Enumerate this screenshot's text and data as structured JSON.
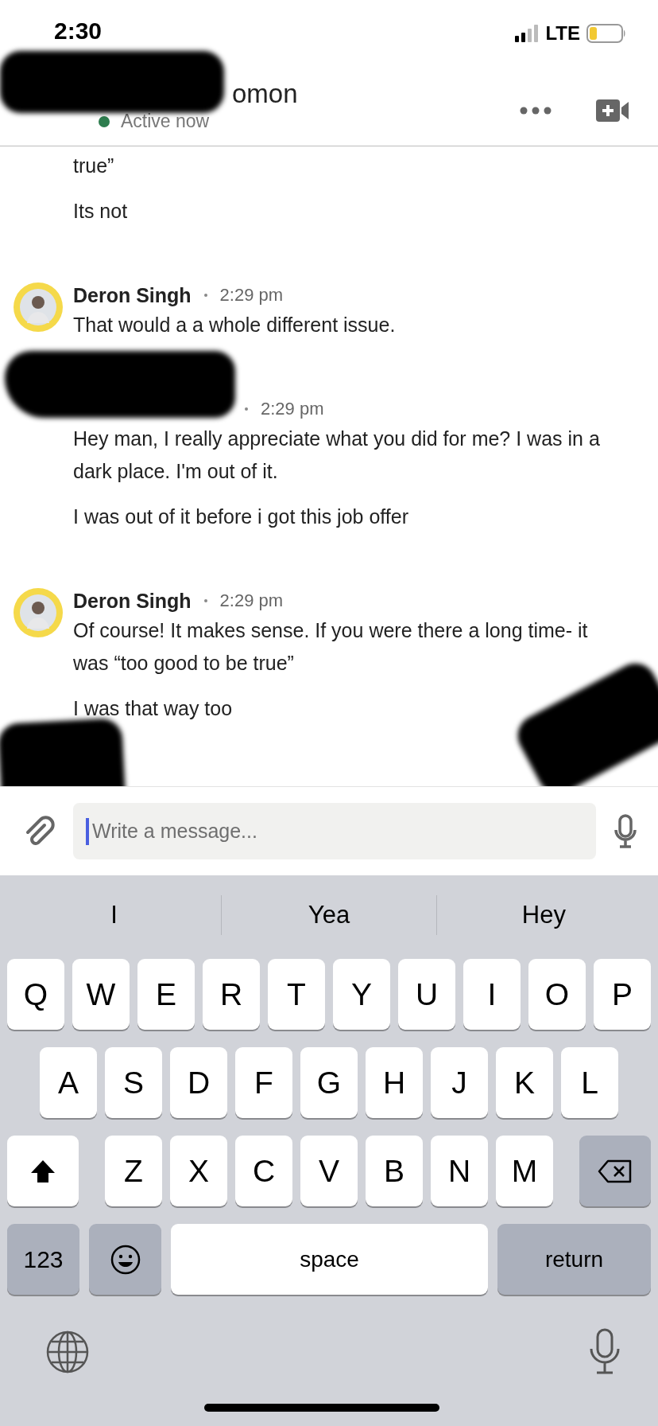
{
  "status_bar": {
    "time": "2:30",
    "network": "LTE"
  },
  "header": {
    "name": "omon",
    "presence": "Active now",
    "online": true,
    "redacted": true
  },
  "messages": [
    {
      "redacted": false,
      "lines": [
        "true”",
        "Its not"
      ]
    },
    {
      "author": "Deron Singh",
      "time": "2:29 pm",
      "redacted": false,
      "lines": [
        "That would a a whole different issue."
      ]
    },
    {
      "time": "2:29 pm",
      "redacted": true,
      "lines": [
        "Hey man, I really appreciate what you did for me? I was in a dark place. I'm out of it.",
        "I was out of it before i got this job offer"
      ]
    },
    {
      "author": "Deron Singh",
      "time": "2:29 pm",
      "redacted": true,
      "lines": [
        "Of course! It makes sense. If you were there a long time- it was “too good to be true”",
        "I was that way too"
      ]
    }
  ],
  "composer": {
    "placeholder": "Write a message..."
  },
  "keyboard": {
    "suggestions": [
      "I",
      "Yea",
      "Hey"
    ],
    "rows": [
      {
        "keys": [
          {
            "kind": "letter",
            "label": "Q"
          },
          {
            "kind": "letter",
            "label": "W"
          },
          {
            "kind": "letter",
            "label": "E"
          },
          {
            "kind": "letter",
            "label": "R"
          },
          {
            "kind": "letter",
            "label": "T"
          },
          {
            "kind": "letter",
            "label": "Y"
          },
          {
            "kind": "letter",
            "label": "U"
          },
          {
            "kind": "letter",
            "label": "I"
          },
          {
            "kind": "letter",
            "label": "O"
          },
          {
            "kind": "letter",
            "label": "P"
          }
        ]
      },
      {
        "keys": [
          {
            "kind": "letter",
            "label": "A"
          },
          {
            "kind": "letter",
            "label": "S"
          },
          {
            "kind": "letter",
            "label": "D"
          },
          {
            "kind": "letter",
            "label": "F"
          },
          {
            "kind": "letter",
            "label": "G"
          },
          {
            "kind": "letter",
            "label": "H"
          },
          {
            "kind": "letter",
            "label": "J"
          },
          {
            "kind": "letter",
            "label": "K"
          },
          {
            "kind": "letter",
            "label": "L"
          }
        ]
      },
      {
        "keys": [
          {
            "kind": "shift"
          },
          {
            "kind": "letter",
            "label": "Z"
          },
          {
            "kind": "letter",
            "label": "X"
          },
          {
            "kind": "letter",
            "label": "C"
          },
          {
            "kind": "letter",
            "label": "V"
          },
          {
            "kind": "letter",
            "label": "B"
          },
          {
            "kind": "letter",
            "label": "N"
          },
          {
            "kind": "letter",
            "label": "M"
          },
          {
            "kind": "backspace"
          }
        ]
      },
      {
        "keys": [
          {
            "kind": "mode",
            "label": "123"
          },
          {
            "kind": "emoji"
          },
          {
            "kind": "space",
            "label": "space"
          },
          {
            "kind": "return",
            "label": "return"
          }
        ]
      }
    ]
  }
}
